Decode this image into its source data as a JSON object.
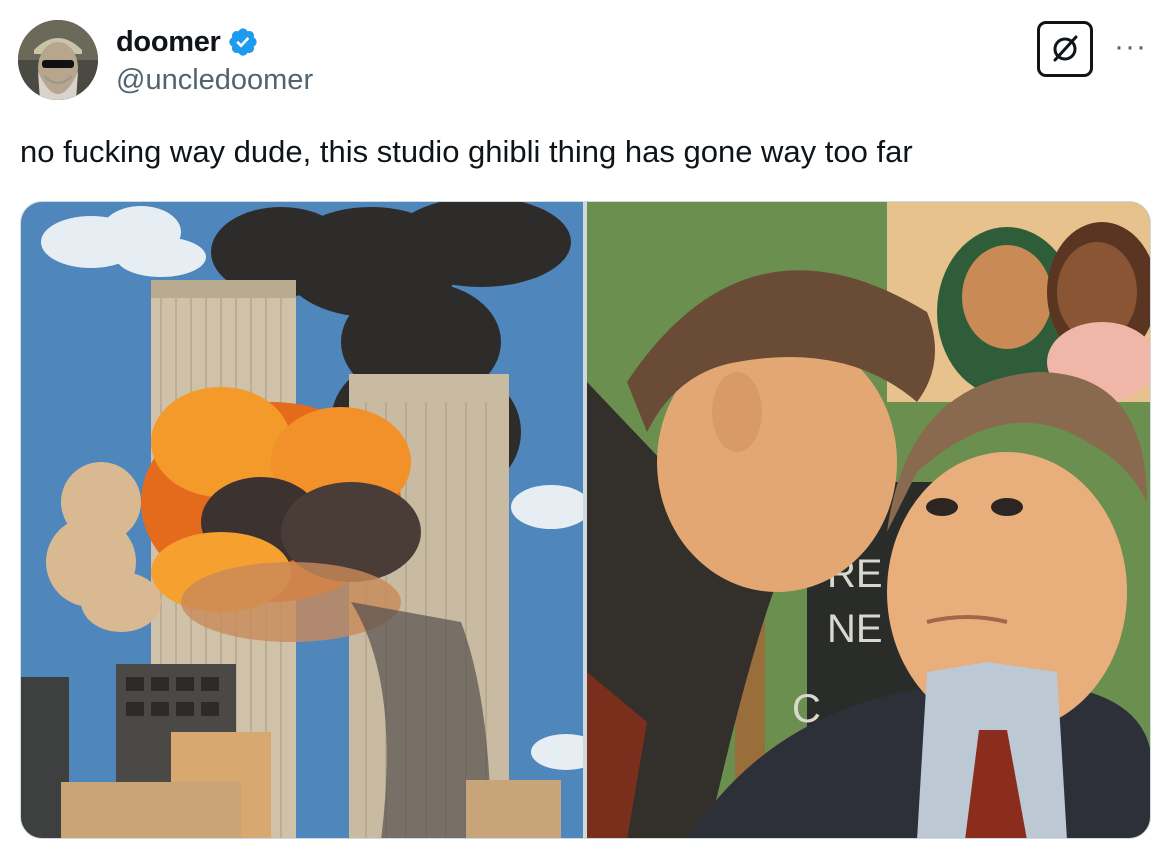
{
  "author": {
    "display_name": "doomer",
    "handle": "@uncledoomer",
    "verified": true,
    "avatar_icon": "bearded-man-avatar"
  },
  "actions": {
    "grok_icon": "grok-slashed-circle-icon",
    "more_icon": "more-options-icon",
    "more_label": "···"
  },
  "tweet": {
    "text": "no fucking way dude, this studio ghibli thing has gone way too far"
  },
  "media": {
    "left_image": "illustrated-twin-towers-explosion",
    "right_image": "illustrated-man-whispering-to-president",
    "sign_text_lines": [
      "RE",
      "NE",
      "C"
    ]
  },
  "colors": {
    "verified_blue": "#1d9bf0",
    "text_primary": "#0f1419",
    "text_secondary": "#536471",
    "border": "#cfd9de"
  }
}
